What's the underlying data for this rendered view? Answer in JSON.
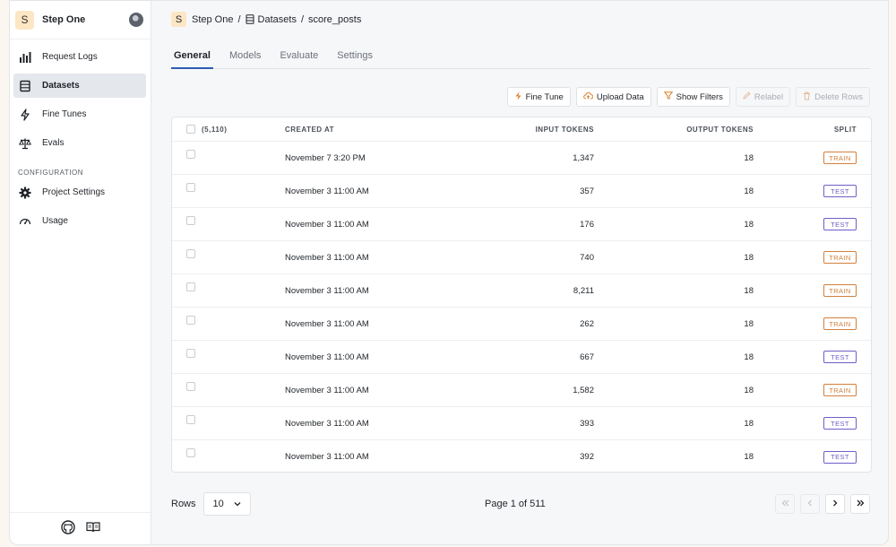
{
  "project": {
    "badge": "S",
    "name": "Step One"
  },
  "sidebar": {
    "items": [
      {
        "label": "Request Logs",
        "icon": "bar-chart-icon"
      },
      {
        "label": "Datasets",
        "icon": "database-icon",
        "active": true
      },
      {
        "label": "Fine Tunes",
        "icon": "lightning-icon"
      },
      {
        "label": "Evals",
        "icon": "scale-icon"
      }
    ],
    "config_label": "CONFIGURATION",
    "config_items": [
      {
        "label": "Project Settings",
        "icon": "gear-icon"
      },
      {
        "label": "Usage",
        "icon": "gauge-icon"
      }
    ]
  },
  "breadcrumb": {
    "badge": "S",
    "project": "Step One",
    "sep": "/",
    "datasets": "Datasets",
    "dataset": "score_posts"
  },
  "tabs": [
    {
      "label": "General",
      "active": true
    },
    {
      "label": "Models"
    },
    {
      "label": "Evaluate"
    },
    {
      "label": "Settings"
    }
  ],
  "toolbar": {
    "fine_tune": "Fine Tune",
    "upload": "Upload Data",
    "filters": "Show Filters",
    "relabel": "Relabel",
    "delete": "Delete Rows"
  },
  "table": {
    "count": "(5,110)",
    "headers": {
      "created": "CREATED AT",
      "input": "INPUT TOKENS",
      "output": "OUTPUT TOKENS",
      "split": "SPLIT"
    },
    "rows": [
      {
        "created": "November 7 3:20 PM",
        "input": "1,347",
        "output": "18",
        "split": "TRAIN"
      },
      {
        "created": "November 3 11:00 AM",
        "input": "357",
        "output": "18",
        "split": "TEST"
      },
      {
        "created": "November 3 11:00 AM",
        "input": "176",
        "output": "18",
        "split": "TEST"
      },
      {
        "created": "November 3 11:00 AM",
        "input": "740",
        "output": "18",
        "split": "TRAIN"
      },
      {
        "created": "November 3 11:00 AM",
        "input": "8,211",
        "output": "18",
        "split": "TRAIN"
      },
      {
        "created": "November 3 11:00 AM",
        "input": "262",
        "output": "18",
        "split": "TRAIN"
      },
      {
        "created": "November 3 11:00 AM",
        "input": "667",
        "output": "18",
        "split": "TEST"
      },
      {
        "created": "November 3 11:00 AM",
        "input": "1,582",
        "output": "18",
        "split": "TRAIN"
      },
      {
        "created": "November 3 11:00 AM",
        "input": "393",
        "output": "18",
        "split": "TEST"
      },
      {
        "created": "November 3 11:00 AM",
        "input": "392",
        "output": "18",
        "split": "TEST"
      }
    ]
  },
  "pagination": {
    "rows_label": "Rows",
    "rows_value": "10",
    "page_text": "Page 1 of 511"
  },
  "colors": {
    "train": "#d2803d",
    "test": "#6d5fc7",
    "accent": "#2c5db0",
    "badge": "#fde6c4"
  }
}
